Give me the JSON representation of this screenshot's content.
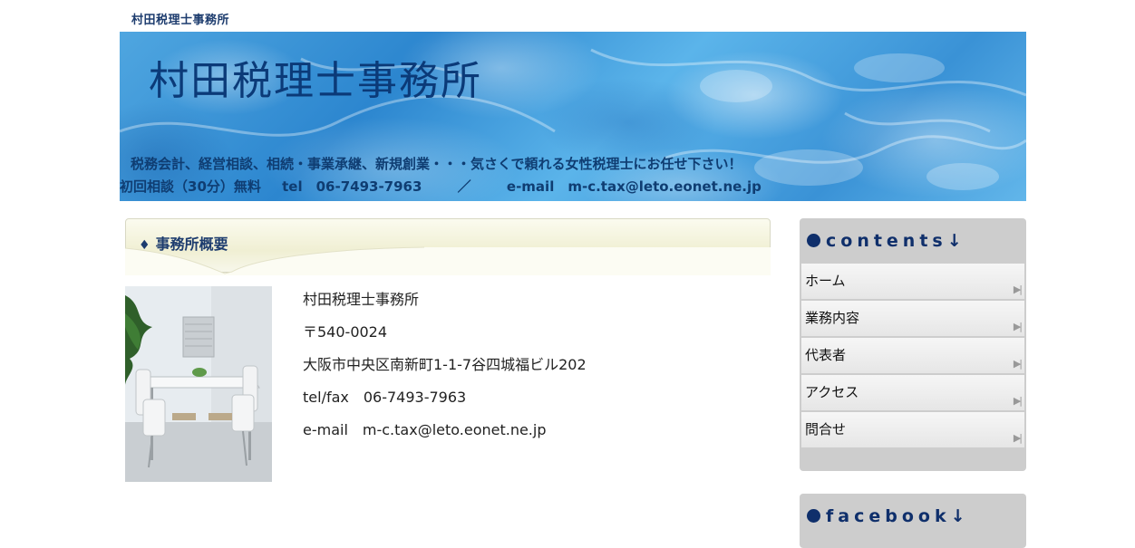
{
  "header": {
    "small_title": "村田税理士事務所",
    "banner_name": "村田税理士事務所",
    "tagline": "税務会計、経営相談、相続・事業承継、新規創業・・・気さくで頼れる女性税理士にお任せ下さい！",
    "contact_consult": "初回相談（30分）無料",
    "contact_tel": "tel　06-7493-7963",
    "contact_sep": "／",
    "contact_email": "e-mail　m-c.tax@leto.eonet.ne.jp"
  },
  "main": {
    "section_icon": "♦",
    "section_title": "事務所概要",
    "photo": "office-interior-photo",
    "info": {
      "name": "村田税理士事務所",
      "postal": "〒540-0024",
      "address": "大阪市中央区南新町1-1-7谷四城福ビル202",
      "telfax": "tel/fax　06-7493-7963",
      "email": "e-mail　m-c.tax@leto.eonet.ne.jp"
    }
  },
  "sidebar": {
    "contents_title": "contents↓",
    "menu": [
      {
        "label": "ホーム",
        "arrow": "▶|"
      },
      {
        "label": "業務内容",
        "arrow": "▶|"
      },
      {
        "label": "代表者",
        "arrow": "▶|"
      },
      {
        "label": "アクセス",
        "arrow": "▶|"
      },
      {
        "label": "問合せ",
        "arrow": "▶|"
      }
    ],
    "facebook_title": "facebook↓"
  },
  "colors": {
    "title_blue": "#1d3c6e",
    "sidebar_gray": "#cdcdcd",
    "section_cream": "#f0efd3"
  }
}
